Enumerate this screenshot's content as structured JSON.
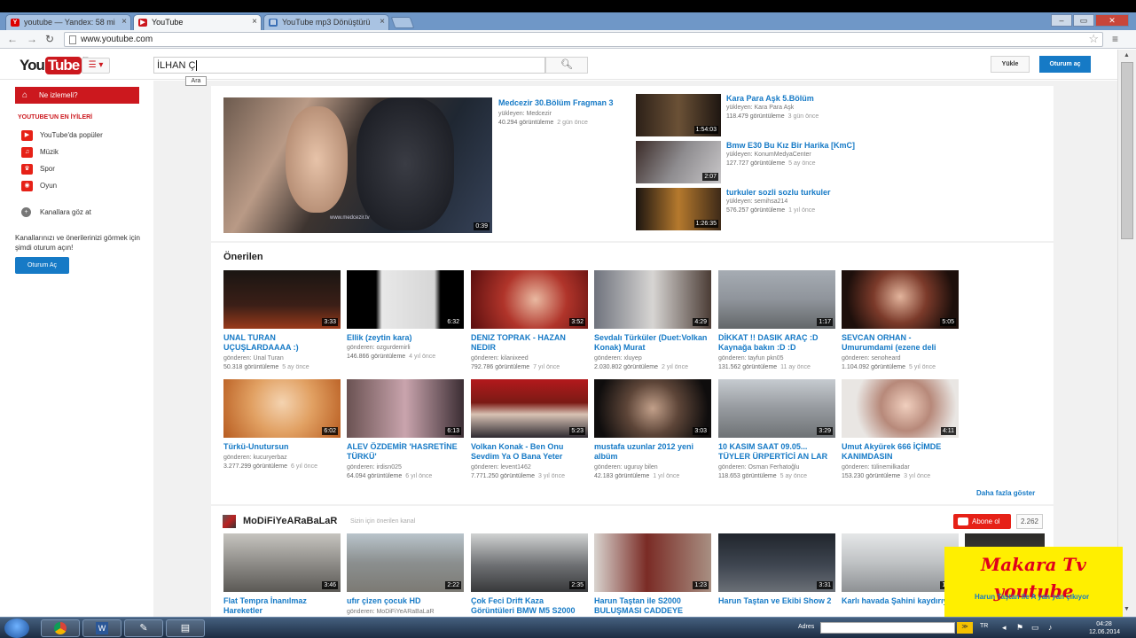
{
  "browser": {
    "tabs": [
      {
        "label": "youtube — Yandex: 58 mi",
        "active": false
      },
      {
        "label": "YouTube",
        "active": true
      },
      {
        "label": "YouTube mp3 Dönüştürü",
        "active": false
      }
    ],
    "url": "www.youtube.com"
  },
  "header": {
    "logo_you": "You",
    "logo_tube": "Tube",
    "logo_tm": "TR",
    "search_value": "İLHAN Ç",
    "search_tooltip": "Ara",
    "upload_label": "Yükle",
    "signin_label": "Oturum aç"
  },
  "guide": {
    "active_item": "Ne izlemeli?",
    "best_heading": "YOUTUBE'UN EN İYİLERİ",
    "items": [
      "YouTube'da popüler",
      "Müzik",
      "Spor",
      "Oyun"
    ],
    "browse_channels": "Kanallara göz at",
    "signin_note": "Kanallarınızı ve önerilerinizi görmek için şimdi oturum açın!",
    "signin_button": "Oturum Aç"
  },
  "featured": {
    "main": {
      "title": "Medcezir 30.Bölüm Fragman 3",
      "uploader": "yükleyen: Medcezir",
      "views": "40.294 görüntüleme",
      "age": "2 gün önce",
      "duration": "0:39",
      "overlay_text": "www.medcezir.tv"
    },
    "side": [
      {
        "title": "Kara Para Aşk 5.Bölüm",
        "uploader": "yükleyen: Kara Para Aşk",
        "views": "118.479 görüntüleme",
        "age": "3 gün önce",
        "duration": "1:54:03"
      },
      {
        "title": "Bmw E30 Bu Kız Bir Harika [KmC]",
        "uploader": "yükleyen: KonumMedyaCenter",
        "views": "127.727 görüntüleme",
        "age": "5 ay önce",
        "duration": "2:07"
      },
      {
        "title": "turkuler sozli sozlu turkuler",
        "uploader": "yükleyen: semihsa214",
        "views": "576.257 görüntüleme",
        "age": "1 yıl önce",
        "duration": "1:26:35"
      }
    ]
  },
  "recommended": {
    "heading": "Önerilen",
    "more_label": "Daha fazla göster",
    "rows": [
      [
        {
          "title": "UNAL TURAN UÇUŞLARDAAAA :)",
          "uploader": "gönderen: Ünal Turan",
          "views": "50.318 görüntüleme",
          "age": "5 ay önce",
          "duration": "3:33"
        },
        {
          "title": "Ellik (zeytin kara)",
          "uploader": "gönderen: ozgurdemirli",
          "views": "146.866 görüntüleme",
          "age": "4 yıl önce",
          "duration": "6:32"
        },
        {
          "title": "DENIZ TOPRAK - HAZAN NEDIR",
          "uploader": "gönderen: kilanixeed",
          "views": "792.786 görüntüleme",
          "age": "7 yıl önce",
          "duration": "3:52"
        },
        {
          "title": "Sevdalı Türküler (Duet:Volkan Konak) Murat",
          "uploader": "gönderen: xluyep",
          "views": "2.030.802 görüntüleme",
          "age": "2 yıl önce",
          "duration": "4:29"
        },
        {
          "title": "DİKKAT !! DASIK ARAÇ :D Kaynağa bakın :D :D",
          "uploader": "gönderen: tayfun pkn05",
          "views": "131.562 görüntüleme",
          "age": "11 ay önce",
          "duration": "1:17"
        },
        {
          "title": "SEVCAN ORHAN - Umurumdami (ezene deli",
          "uploader": "gönderen: senoheard",
          "views": "1.104.092 görüntüleme",
          "age": "5 yıl önce",
          "duration": "5:05"
        }
      ],
      [
        {
          "title": "Türkü-Unutursun",
          "uploader": "gönderen: kucuryerbaz",
          "views": "3.277.299 görüntüleme",
          "age": "6 yıl önce",
          "duration": "6:02"
        },
        {
          "title": "ALEV ÖZDEMİR 'HASRETİNE TÜRKÜ'",
          "uploader": "gönderen: irdisn025",
          "views": "64.094 görüntüleme",
          "age": "6 yıl önce",
          "duration": "6:13"
        },
        {
          "title": "Volkan Konak - Ben Onu Sevdim Ya O Bana Yeter",
          "uploader": "gönderen: levent1462",
          "views": "7.771.250 görüntüleme",
          "age": "3 yıl önce",
          "duration": "5:23"
        },
        {
          "title": "mustafa uzunlar 2012 yeni albüm",
          "uploader": "gönderen: uguruy bilen",
          "views": "42.183 görüntüleme",
          "age": "1 yıl önce",
          "duration": "3:03"
        },
        {
          "title": "10 KASIM SAAT 09.05... TÜYLER ÜRPERTİCİ AN LAR",
          "uploader": "gönderen: Osman Ferhatoğlu",
          "views": "118.653 görüntüleme",
          "age": "5 ay önce",
          "duration": "3:29"
        },
        {
          "title": "Umut Akyürek 666 İÇİMDE KANIMDASIN",
          "uploader": "gönderen: tülinemilkadar",
          "views": "153.230 görüntüleme",
          "age": "3 yıl önce",
          "duration": "4:11"
        }
      ]
    ]
  },
  "channel_section": {
    "name": "MoDiFiYeARaBaLaR",
    "subtitle": "Sizin için önerilen kanal",
    "subscribe_label": "Abone ol",
    "subscriber_count": "2.262",
    "videos": [
      {
        "title": "Flat Tempra İnanılmaz Hareketler",
        "duration": "3:46"
      },
      {
        "title": "ufır çizen çocuk HD",
        "uploader": "gönderen: MoDiFiYeARaBaLaR",
        "duration": "2:22"
      },
      {
        "title": "Çok Feci Drift Kaza Görüntüleri BMW M5 S2000",
        "duration": "2:35"
      },
      {
        "title": "Harun Taştan ile S2000 BULUŞMASI CADDEYE",
        "duration": "1:23"
      },
      {
        "title": "Harun Taştan ve Ekibi Show 2",
        "duration": "3:31"
      },
      {
        "title": "Karlı havada Şahini kaydırıyor",
        "duration": "1:14"
      },
      {
        "title": "Harun Taştan ile A yan yan çıkıyor",
        "duration": ""
      }
    ]
  },
  "watermark": {
    "line1": "Makara Tv",
    "line2": "youtube"
  },
  "taskbar": {
    "address_label": "Adres",
    "go_label": "≫",
    "time": "04:28",
    "date": "12.06.2014",
    "lang": "TR"
  },
  "colors": {
    "youtube_red": "#cc181e",
    "link_blue": "#167ac6",
    "watermark_bg": "#ffef00",
    "watermark_text": "#e0001b"
  }
}
